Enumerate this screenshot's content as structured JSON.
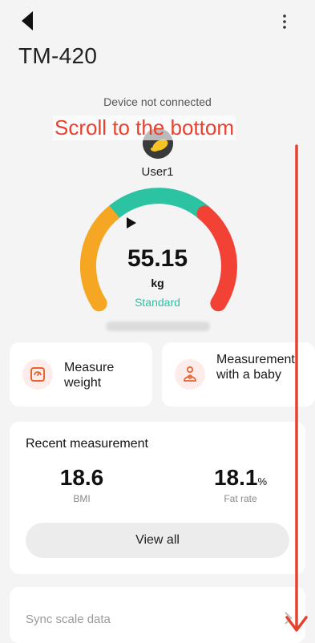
{
  "header": {
    "device_title": "TM-420"
  },
  "connection": {
    "status": "Device not connected"
  },
  "annotation": {
    "text": "Scroll to the bottom",
    "color": "#e8422f"
  },
  "user": {
    "name": "User1"
  },
  "gauge": {
    "weight": "55.15",
    "unit": "kg",
    "category": "Standard",
    "segment_colors": [
      "#f5a623",
      "#2cc3a3",
      "#f24236"
    ]
  },
  "actions": {
    "measure_weight": "Measure weight",
    "measure_baby": "Measurement with a baby"
  },
  "recent": {
    "title": "Recent measurement",
    "bmi_value": "18.6",
    "bmi_label": "BMI",
    "fat_value": "18.1",
    "fat_unit": "%",
    "fat_label": "Fat rate",
    "view_all": "View all"
  },
  "sync": {
    "label": "Sync scale data"
  },
  "icons": [
    "back-arrow-icon",
    "more-vertical-icon",
    "scale-icon",
    "baby-icon",
    "chevron-right-icon",
    "down-arrow-icon"
  ]
}
